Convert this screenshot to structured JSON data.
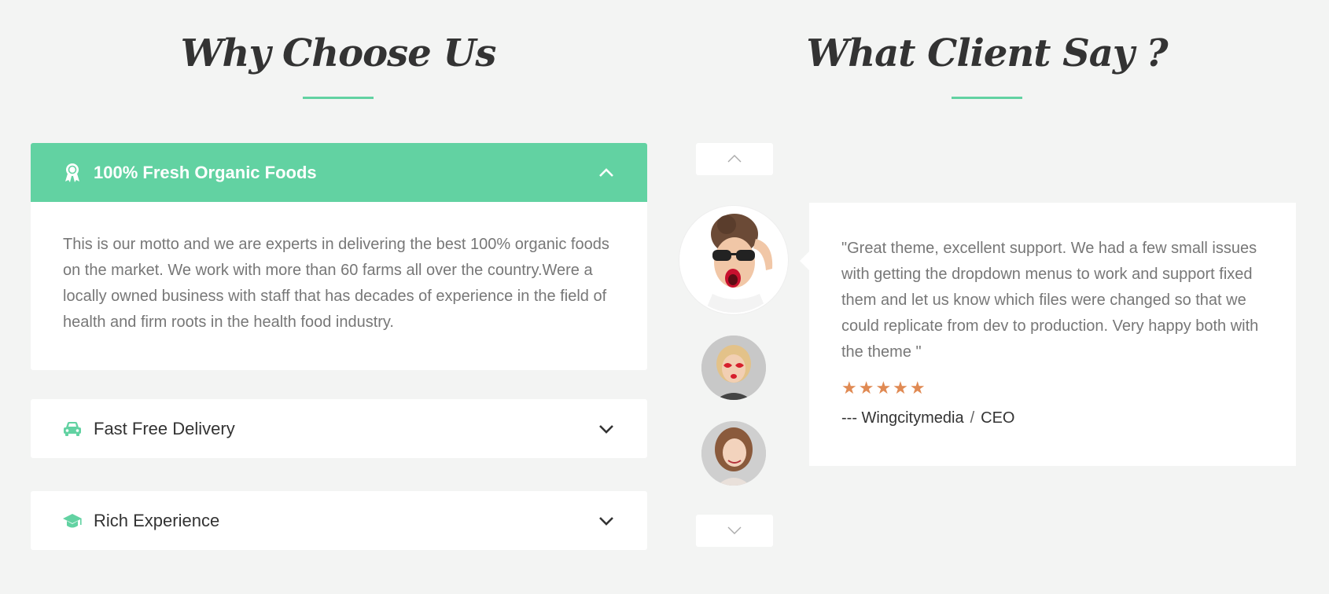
{
  "why": {
    "title": "Why Choose Us",
    "panels": [
      {
        "label": "100% Fresh Organic Foods",
        "icon": "award-ribbon-icon",
        "expanded": true,
        "body": "This is our motto and we are experts in delivering the best 100% organic foods on the market. We work with more than 60 farms all over the country.Were a locally owned business with staff that has decades of experience in the field of health and firm roots in the health food industry."
      },
      {
        "label": "Fast Free Delivery",
        "icon": "car-icon",
        "expanded": false
      },
      {
        "label": "Rich Experience",
        "icon": "graduation-cap-icon",
        "expanded": false
      }
    ]
  },
  "client": {
    "title": "What Client Say ?",
    "quote": "\"Great theme, excellent support. We had a few small issues with getting the dropdown menus to work and support fixed them and let us know which files were changed so that we could replicate from dev to production. Very happy both with the theme \"",
    "stars": "★★★★★",
    "author_prefix": "--- Wingcitymedia",
    "author_sep": "/",
    "author_role": "CEO"
  },
  "colors": {
    "accent": "#62d2a2",
    "star": "#e08a53",
    "background": "#f3f4f3"
  }
}
